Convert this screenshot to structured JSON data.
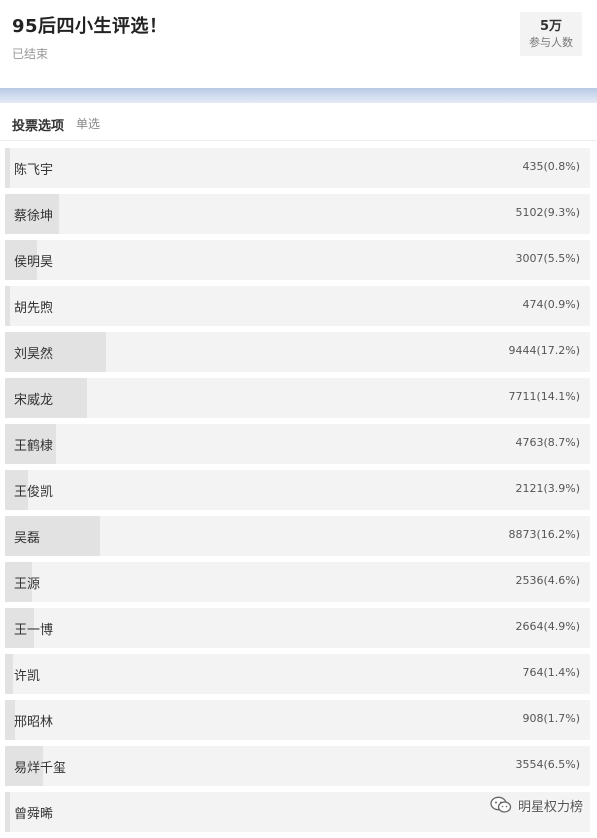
{
  "header": {
    "title": "95后四小生评选！",
    "status": "已结束",
    "participants": {
      "count": "5万",
      "label": "参与人数"
    }
  },
  "section": {
    "title": "投票选项",
    "type": "单选"
  },
  "options": [
    {
      "name": "陈飞宇",
      "result": "435(0.8%)",
      "share": 0.008
    },
    {
      "name": "蔡徐坤",
      "result": "5102(9.3%)",
      "share": 0.093
    },
    {
      "name": "侯明昊",
      "result": "3007(5.5%)",
      "share": 0.055
    },
    {
      "name": "胡先煦",
      "result": "474(0.9%)",
      "share": 0.009
    },
    {
      "name": "刘昊然",
      "result": "9444(17.2%)",
      "share": 0.172
    },
    {
      "name": "宋威龙",
      "result": "7711(14.1%)",
      "share": 0.141
    },
    {
      "name": "王鹤棣",
      "result": "4763(8.7%)",
      "share": 0.087
    },
    {
      "name": "王俊凯",
      "result": "2121(3.9%)",
      "share": 0.039
    },
    {
      "name": "吴磊",
      "result": "8873(16.2%)",
      "share": 0.162
    },
    {
      "name": "王源",
      "result": "2536(4.6%)",
      "share": 0.046
    },
    {
      "name": "王一博",
      "result": "2664(4.9%)",
      "share": 0.049
    },
    {
      "name": "许凯",
      "result": "764(1.4%)",
      "share": 0.014
    },
    {
      "name": "邢昭林",
      "result": "908(1.7%)",
      "share": 0.017
    },
    {
      "name": "易烊千玺",
      "result": "3554(6.5%)",
      "share": 0.065
    },
    {
      "name": "曾舜晞",
      "result": "",
      "share": 0.0
    }
  ],
  "watermark": {
    "text": "明星权力榜",
    "icon": "wechat-icon"
  },
  "colors": {
    "bar_track": "#f3f3f3",
    "bar_fill": "#e2e2e2",
    "band": "#c8d6ec"
  }
}
